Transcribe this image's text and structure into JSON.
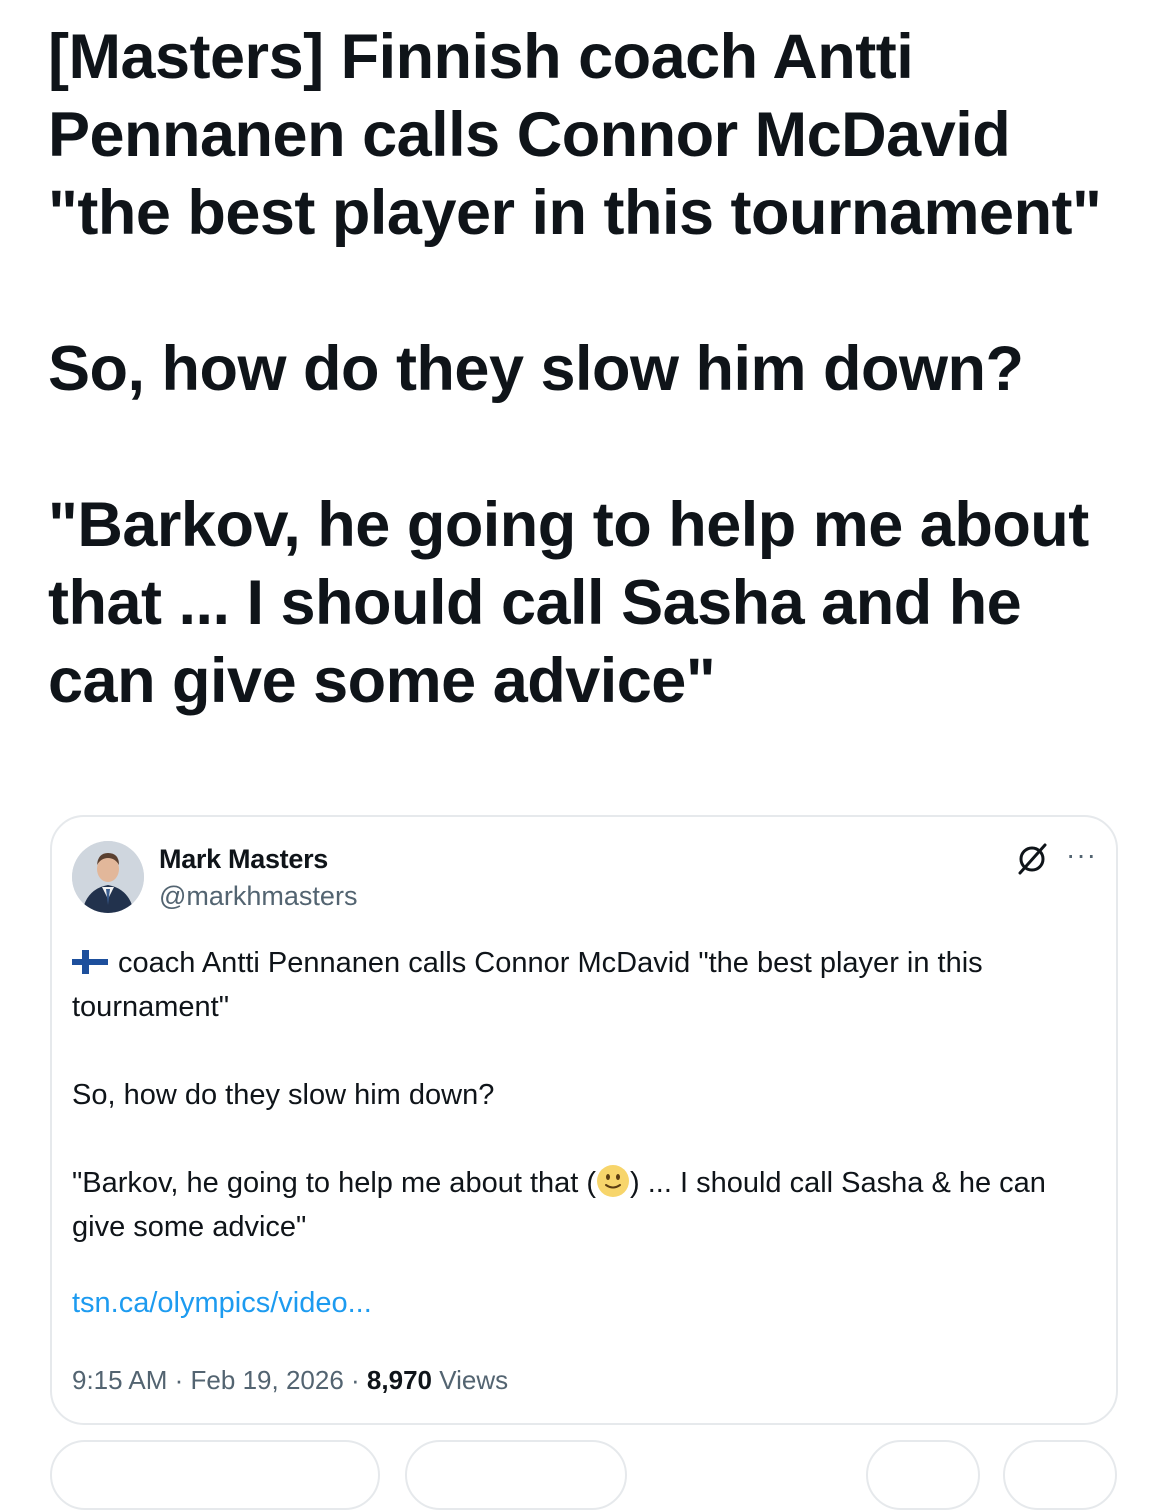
{
  "headline": {
    "line1": "[Masters] Finnish coach Antti Pennanen calls Connor McDavid \"the best player in this tournament\"",
    "line2": "So, how do they slow him down?",
    "line3": "\"Barkov, he going to help me about that ... I should call Sasha and he can give some advice\""
  },
  "tweet": {
    "author_name": "Mark Masters",
    "author_handle": "@markhmasters",
    "flag_icon": "finland-flag-icon",
    "text_line1": "coach Antti Pennanen calls Connor McDavid \"the best player in this tournament\"",
    "text_line2": "So, how do they slow him down?",
    "text_line3_start": "\"Barkov, he going to help me about that (",
    "emoji_icon": "slightly-smiling-face-icon",
    "text_line3_end": ") ... I should call Sasha & he can give some advice\"",
    "link": "tsn.ca/olympics/video...",
    "time": "9:15 AM",
    "separator": "·",
    "date": "Feb 19, 2026",
    "views_count": "8,970",
    "views_label": "Views"
  },
  "colors": {
    "text": "#0f1419",
    "secondary": "#536471",
    "link": "#1d9bf0",
    "border": "#e6e9ec"
  }
}
